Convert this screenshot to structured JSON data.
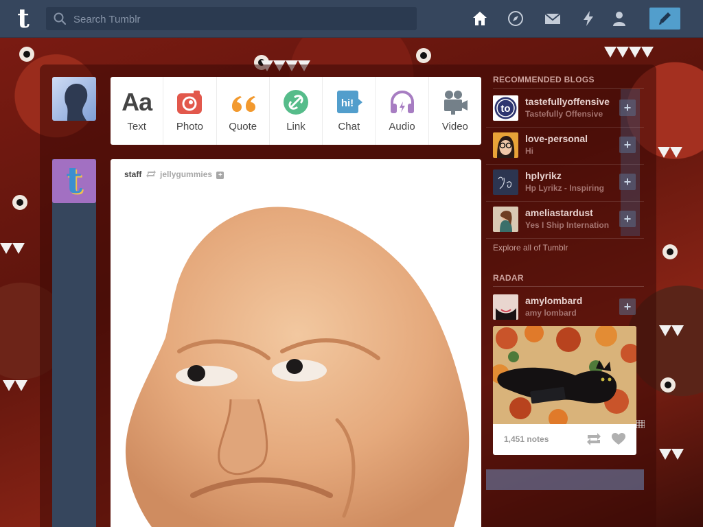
{
  "header": {
    "logo_letter": "t",
    "search_placeholder": "Search Tumblr",
    "nav_icons": [
      "home-icon",
      "compass-icon",
      "mail-icon",
      "lightning-icon",
      "account-icon",
      "pencil-icon"
    ],
    "accent_color": "#529ecc",
    "bar_color": "#36465d"
  },
  "post_types": [
    {
      "label": "Text",
      "glyph": "Aa",
      "icon": "text-icon"
    },
    {
      "label": "Photo",
      "icon": "camera-icon",
      "color": "#e2584c"
    },
    {
      "label": "Quote",
      "glyph": "“",
      "icon": "quote-icon",
      "color": "#f2992e"
    },
    {
      "label": "Link",
      "icon": "link-icon",
      "color": "#56bc8a"
    },
    {
      "label": "Chat",
      "glyph": "hi!",
      "icon": "chat-icon",
      "color": "#529ecc"
    },
    {
      "label": "Audio",
      "icon": "headphones-icon",
      "color": "#a77dc2"
    },
    {
      "label": "Video",
      "icon": "video-camera-icon",
      "color": "#748089"
    }
  ],
  "post": {
    "author": "staff",
    "reblogged_from": "jellygummies",
    "reblog_icon": "reblog-icon",
    "follow_glyph": "+"
  },
  "sidebar": {
    "recommended_title": "RECOMMENDED BLOGS",
    "blogs": [
      {
        "name": "tastefullyoffensive",
        "desc": "Tastefully Offensive",
        "avatar_text": "to"
      },
      {
        "name": "love-personal",
        "desc": "Hi"
      },
      {
        "name": "hplyrikz",
        "desc": "Hp Lyrikz - Inspiring"
      },
      {
        "name": "ameliastardust",
        "desc": "Yes I Ship Internation"
      }
    ],
    "explore": "Explore all of Tumblr",
    "radar_title": "RADAR",
    "radar": {
      "name": "amylombard",
      "desc": "amy lombard",
      "notes": "1,451 notes"
    },
    "follow_glyph": "+"
  }
}
